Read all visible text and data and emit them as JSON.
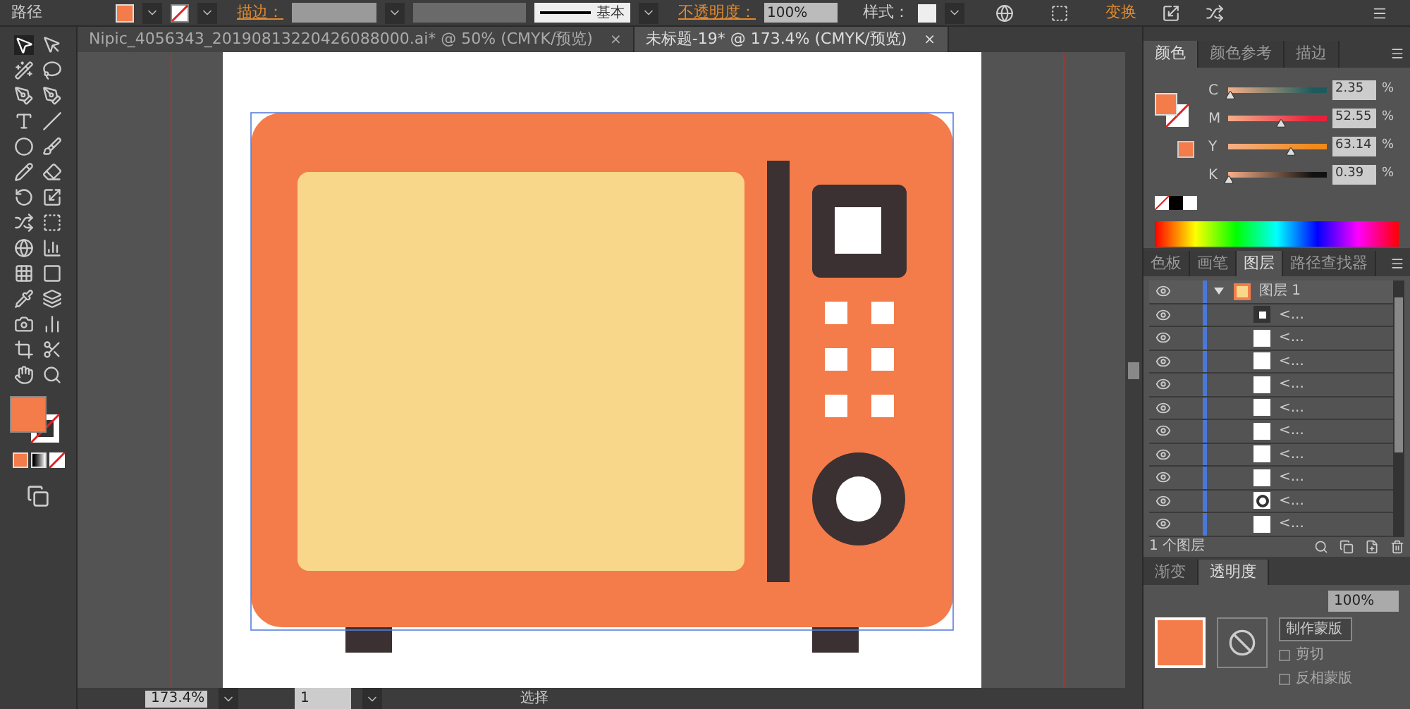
{
  "control_bar": {
    "label": "路径",
    "stroke_label": "描边：",
    "stroke_style": "基本",
    "opacity_label": "不透明度：",
    "opacity": "100%",
    "style_label": "样式：",
    "transform": "变换"
  },
  "document_tabs": [
    {
      "title": "Nipic_4056343_20190813220426088000.ai* @ 50% (CMYK/预览)",
      "close": "×",
      "selected": false
    },
    {
      "title": "未标题-19* @ 173.4% (CMYK/预览)",
      "close": "×",
      "selected": true
    }
  ],
  "color_panel": {
    "tabs": [
      {
        "label": "颜色",
        "selected": true
      },
      {
        "label": "颜色参考",
        "selected": false
      },
      {
        "label": "描边",
        "selected": false
      }
    ],
    "sliders": [
      {
        "channel": "C",
        "level": 0.02,
        "value": "2.35",
        "unit": "%",
        "color": "#1e5a5c"
      },
      {
        "channel": "M",
        "level": 0.53,
        "value": "52.55",
        "unit": "%",
        "color": "#e8203c"
      },
      {
        "channel": "Y",
        "level": 0.63,
        "value": "63.14",
        "unit": "%",
        "color": "#f08a1a"
      },
      {
        "channel": "K",
        "level": 0.0,
        "value": "0.39",
        "unit": "%",
        "color": "#111111"
      }
    ]
  },
  "layers_panel": {
    "tabs": [
      {
        "label": "色板",
        "selected": false
      },
      {
        "label": "画笔",
        "selected": false
      },
      {
        "label": "图层",
        "selected": true
      },
      {
        "label": "路径查找器",
        "selected": false
      }
    ],
    "layer": {
      "name": "图层 1",
      "expanded": true,
      "children": [
        {
          "name": "<...",
          "kind": "framed"
        },
        {
          "name": "<...",
          "kind": "plain"
        },
        {
          "name": "<...",
          "kind": "plain"
        },
        {
          "name": "<...",
          "kind": "plain"
        },
        {
          "name": "<...",
          "kind": "plain"
        },
        {
          "name": "<...",
          "kind": "plain"
        },
        {
          "name": "<...",
          "kind": "plain"
        },
        {
          "name": "<...",
          "kind": "plain"
        },
        {
          "name": "<...",
          "kind": "ring"
        },
        {
          "name": "<...",
          "kind": "plain"
        }
      ]
    },
    "footer": "1 个图层"
  },
  "transparency_panel": {
    "tabs": [
      {
        "label": "渐变",
        "selected": false
      },
      {
        "label": "透明度",
        "selected": true
      }
    ],
    "opacity": "100%",
    "make_mask": "制作蒙版",
    "options": [
      {
        "label": "剪切",
        "checked": false
      },
      {
        "label": "反相蒙版",
        "checked": false
      }
    ]
  },
  "status_bar": {
    "zoom": "173.4%",
    "artboard": "1",
    "tool": "选择"
  }
}
